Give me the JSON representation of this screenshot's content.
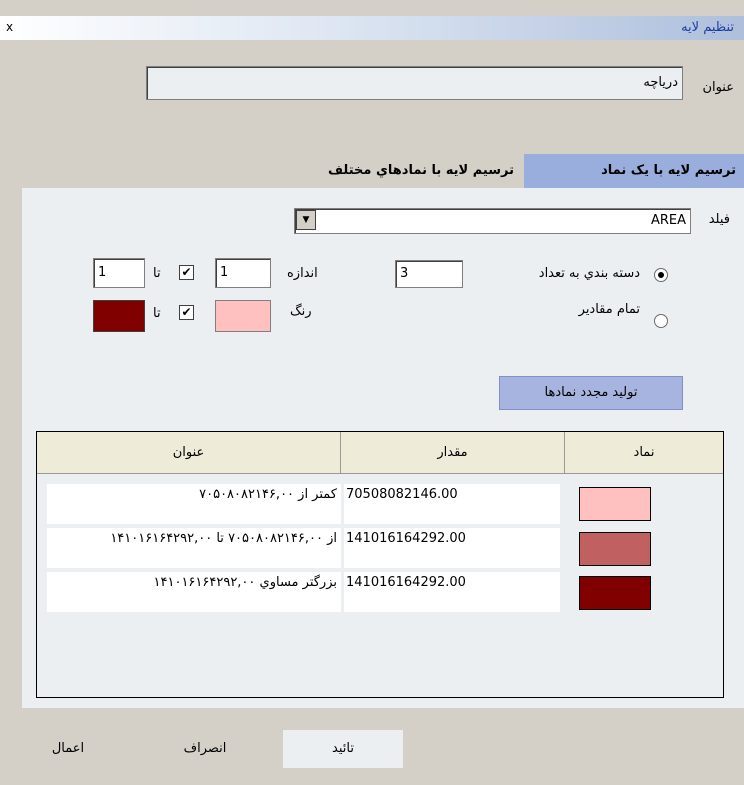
{
  "window": {
    "title": "تنظيم لايه",
    "close_label": "x"
  },
  "title_field": {
    "label": "عنوان",
    "value": "درياچه"
  },
  "tabs": [
    {
      "label": "ترسيم لايه با يک نماد",
      "active": true
    },
    {
      "label": "ترسيم لايه با نمادهاي مختلف",
      "active": false
    }
  ],
  "field_select": {
    "label": "فيلد",
    "value": "AREA"
  },
  "classify": {
    "radio_count_label": "دسته بندي به تعداد",
    "count_value": "3",
    "radio_all_label": "تمام مقادير",
    "selected": "count"
  },
  "size": {
    "label": "اندازه",
    "from": "1",
    "to_label": "تا",
    "to": "1",
    "checked": true
  },
  "color": {
    "label": "رنگ",
    "from": "#ffc0c0",
    "to_label": "تا",
    "to": "#800000",
    "checked": true
  },
  "regen_button": "توليد مجدد نمادها",
  "table": {
    "headers": {
      "symbol": "نماد",
      "value": "مقدار",
      "title": "عنوان"
    },
    "rows": [
      {
        "color": "#ffc0c0",
        "value": "70508082146.00",
        "title": "کمتر از ۷۰۵۰۸۰۸۲۱۴۶,۰۰"
      },
      {
        "color": "#c06060",
        "value": "141016164292.00",
        "title": "از ۷۰۵۰۸۰۸۲۱۴۶,۰۰ تا ۱۴۱۰۱۶۱۶۴۲۹۲,۰۰"
      },
      {
        "color": "#800000",
        "value": "141016164292.00",
        "title": "بزرگتر مساوي ۱۴۱۰۱۶۱۶۴۲۹۲,۰۰"
      }
    ]
  },
  "buttons": {
    "ok": "تائيد",
    "cancel": "انصراف",
    "apply": "اعمال"
  }
}
